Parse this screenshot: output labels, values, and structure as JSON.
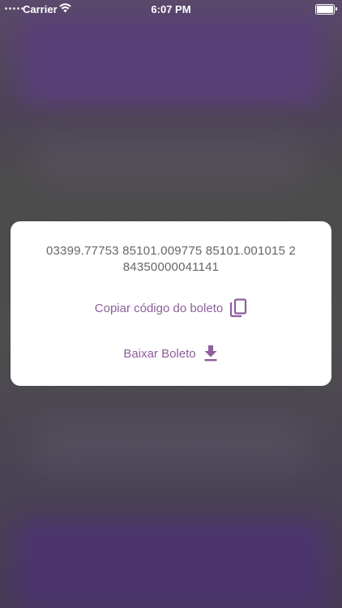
{
  "status_bar": {
    "carrier": "Carrier",
    "time": "6:07 PM",
    "icons": [
      "signal-dots-icon",
      "wifi-icon",
      "battery-icon"
    ]
  },
  "modal": {
    "code_line1": "03399.77753  85101.009775  85101.001015  2",
    "code_line2": "84350000041141",
    "copy_label": "Copiar código do boleto",
    "download_label": "Baixar Boleto",
    "copy_icon": "copy-icon",
    "download_icon": "download-icon"
  },
  "colors": {
    "accent": "#8e5e9a",
    "code_text": "#666666",
    "overlay": "#4a4a4a",
    "brand_purple": "#5a3f7a"
  }
}
